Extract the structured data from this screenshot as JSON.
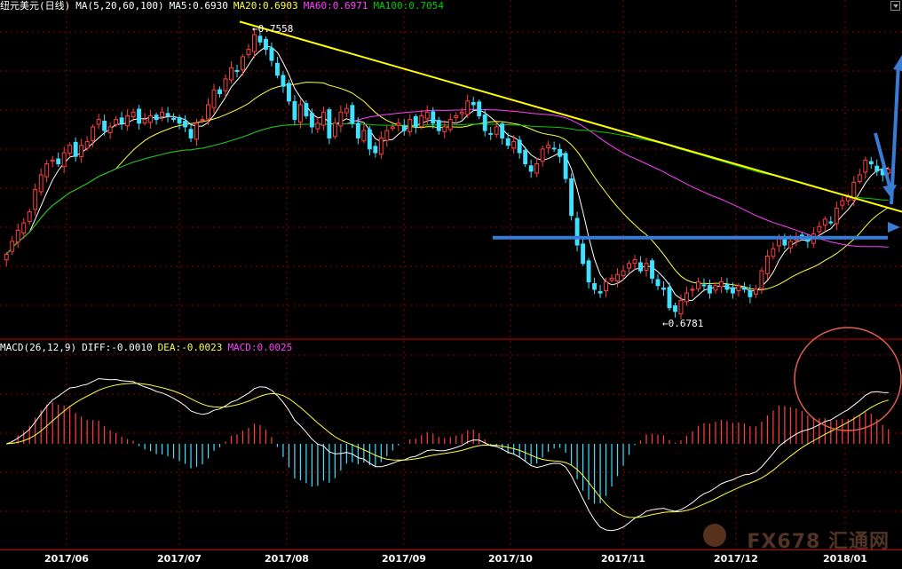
{
  "header": {
    "instrument": "纽元美元(日线)",
    "ma_params": "MA(5,20,60,100)",
    "ma5": "MA5:0.6930",
    "ma20": "MA20:0.6903",
    "ma60": "MA60:0.6971",
    "ma100": "MA100:0.7054"
  },
  "macd_header": {
    "params": "MACD(26,12,9)",
    "diff": "DIFF:-0.0010",
    "dea": "DEA:-0.0023",
    "macd": "MACD:0.0025"
  },
  "colors": {
    "up": "#ff4040",
    "down": "#40e0ff",
    "ma5": "#ffffff",
    "ma20": "#ffff40",
    "ma60": "#ff40ff",
    "ma100": "#00cc00",
    "trendline": "#ffff00",
    "annotation": "#3a7bd5",
    "circle": "#e06050",
    "grid": "#8b0000"
  },
  "watermark": "FX678 汇通网",
  "chart_data": {
    "type": "candlestick",
    "x_ticks": [
      "2017/06",
      "2017/07",
      "2017/08",
      "2017/09",
      "2017/10",
      "2017/11",
      "2017/12",
      "2018/01"
    ],
    "ylim": [
      0.672,
      0.76
    ],
    "annotations": [
      {
        "label": "0.7558",
        "value": 0.7558,
        "date": "2017/07/27"
      },
      {
        "label": "0.6781",
        "value": 0.6781,
        "date": "2017/11/17"
      }
    ],
    "ma_last": {
      "MA5": 0.693,
      "MA20": 0.6903,
      "MA60": 0.6971,
      "MA100": 0.7054
    },
    "close": [
      0.6945,
      0.698,
      0.701,
      0.703,
      0.706,
      0.712,
      0.716,
      0.719,
      0.72,
      0.719,
      0.722,
      0.724,
      0.721,
      0.724,
      0.725,
      0.729,
      0.731,
      0.728,
      0.729,
      0.731,
      0.73,
      0.732,
      0.733,
      0.73,
      0.731,
      0.732,
      0.731,
      0.733,
      0.732,
      0.731,
      0.73,
      0.729,
      0.726,
      0.73,
      0.731,
      0.735,
      0.739,
      0.738,
      0.742,
      0.745,
      0.744,
      0.748,
      0.75,
      0.754,
      0.752,
      0.75,
      0.747,
      0.743,
      0.74,
      0.736,
      0.731,
      0.735,
      0.732,
      0.729,
      0.73,
      0.733,
      0.726,
      0.73,
      0.733,
      0.734,
      0.73,
      0.726,
      0.728,
      0.723,
      0.722,
      0.726,
      0.728,
      0.729,
      0.73,
      0.728,
      0.731,
      0.729,
      0.732,
      0.733,
      0.73,
      0.728,
      0.729,
      0.731,
      0.732,
      0.733,
      0.736,
      0.735,
      0.732,
      0.728,
      0.727,
      0.729,
      0.726,
      0.724,
      0.725,
      0.722,
      0.719,
      0.717,
      0.719,
      0.723,
      0.724,
      0.723,
      0.721,
      0.715,
      0.705,
      0.697,
      0.692,
      0.687,
      0.685,
      0.684,
      0.687,
      0.688,
      0.689,
      0.69,
      0.692,
      0.693,
      0.69,
      0.692,
      0.688,
      0.686,
      0.685,
      0.68,
      0.679,
      0.682,
      0.684,
      0.685,
      0.687,
      0.686,
      0.684,
      0.686,
      0.687,
      0.685,
      0.684,
      0.686,
      0.685,
      0.683,
      0.685,
      0.69,
      0.694,
      0.696,
      0.699,
      0.697,
      0.698,
      0.699,
      0.699,
      0.698,
      0.7,
      0.702,
      0.704,
      0.703,
      0.707,
      0.709,
      0.71,
      0.714,
      0.716,
      0.72,
      0.719,
      0.717,
      0.716,
      0.7175
    ],
    "ma5_recent": 0.693,
    "macd": {
      "diff_last": -0.001,
      "dea_last": -0.0023,
      "hist_last": 0.0025
    }
  }
}
